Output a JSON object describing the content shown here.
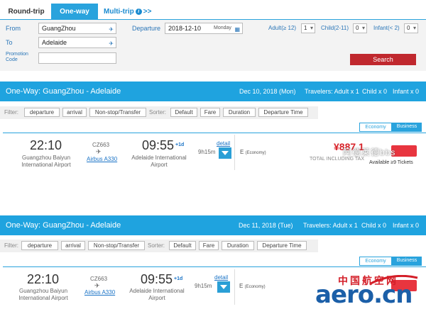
{
  "tabs": [
    {
      "label": "Round-trip"
    },
    {
      "label": "One-way"
    },
    {
      "label": "Multi-trip",
      "suffix": ">>"
    }
  ],
  "search": {
    "from_label": "From",
    "from_value": "GuangZhou",
    "to_label": "To",
    "to_value": "Adelaide",
    "promo_label_1": "Promotion",
    "promo_label_2": "Code",
    "promo_value": "",
    "departure_label": "Departure",
    "departure_value": "2018-12-10",
    "departure_day": "Monday",
    "adult_label": "Adult(≥ 12)",
    "adult_value": "1",
    "child_label": "Child(2-11)",
    "child_value": "0",
    "infant_label": "Infant(< 2)",
    "infant_value": "0",
    "search_button": "Search"
  },
  "filter_labels": {
    "filter": "Filter:",
    "sorter": "Sorter:",
    "departure": "departure",
    "arrival": "arrival",
    "nonstop": "Non-stop/Transfer",
    "default": "Default",
    "fare": "Fare",
    "duration": "Duration",
    "departure_time": "Departure Time"
  },
  "cabins": {
    "economy": "Economy",
    "business": "Business"
  },
  "results": [
    {
      "route": "One-Way:  GuangZhou - Adelaide",
      "date": "Dec 10, 2018 (Mon)",
      "travelers": "Travelers: Adult x 1",
      "child": "Child x 0",
      "infant": "Infant x 0",
      "dep_time": "22:10",
      "dep_airport_1": "Guangzhou Baiyun",
      "dep_airport_2": "International Airport",
      "flight_no": "CZ663",
      "aircraft": "Airbus A330",
      "arr_time": "09:55",
      "arr_plus": "+1d",
      "arr_airport_1": "Adelaide International",
      "arr_airport_2": "Airport",
      "duration": "9h15m",
      "detail": "detail",
      "cabin_class": "E",
      "cabin_class_note": "(Economy)",
      "price": "¥887.1",
      "tax": "TOTAL INCLUDING TAX",
      "availability": "Available ≥9 Tickets"
    },
    {
      "route": "One-Way:  GuangZhou - Adelaide",
      "date": "Dec 11, 2018 (Tue)",
      "travelers": "Travelers: Adult x 1",
      "child": "Child x 0",
      "infant": "Infant x 0",
      "dep_time": "22:10",
      "dep_airport_1": "Guangzhou Baiyun",
      "dep_airport_2": "International Airport",
      "flight_no": "CZ663",
      "aircraft": "Airbus A330",
      "arr_time": "09:55",
      "arr_plus": "+1d",
      "arr_airport_1": "Adelaide International",
      "arr_airport_2": "Airport",
      "duration": "9h15m",
      "detail": "detail",
      "cabin_class": "E",
      "cabin_class_note": "(Economy)"
    }
  ],
  "watermarks": {
    "wechat": "阿德莱德bbs",
    "site_name": "中国航空网",
    "site_logo": "aero.cn"
  },
  "colors": {
    "accent": "#1fa3df",
    "search_button": "#c0282e",
    "price": "#d8232a"
  }
}
